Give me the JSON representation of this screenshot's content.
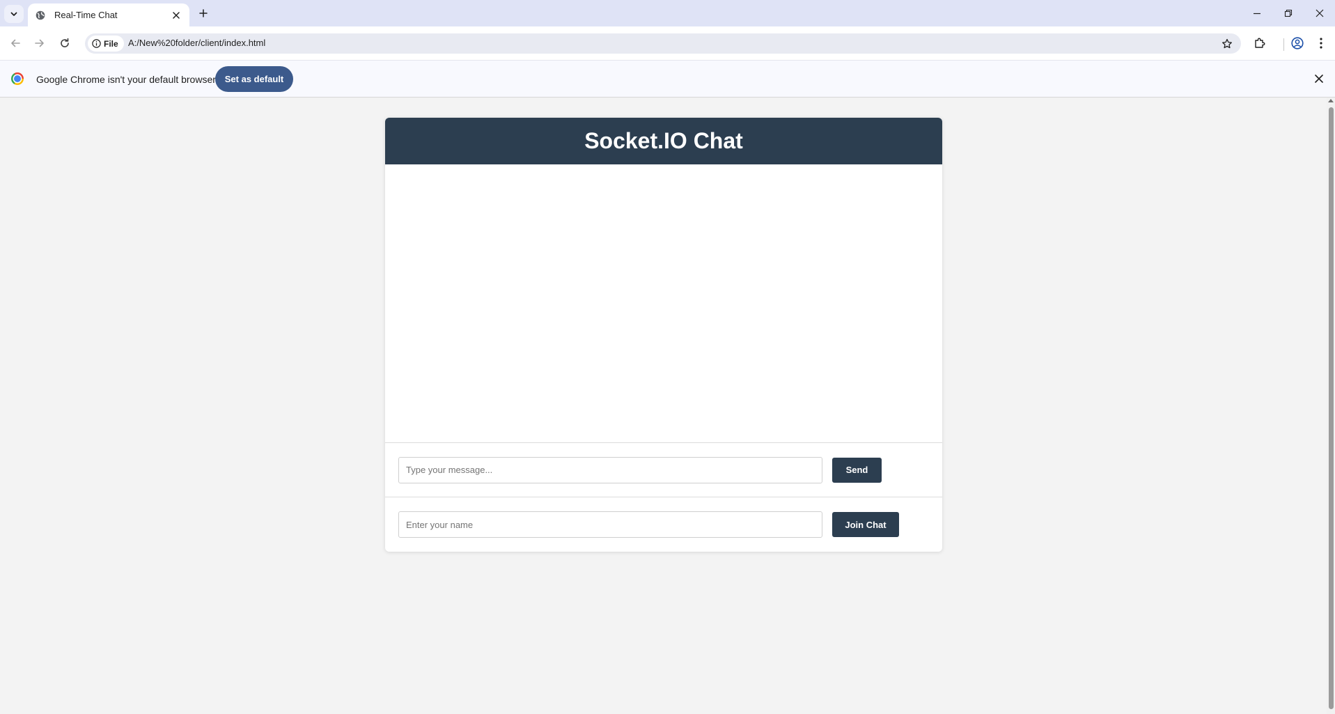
{
  "browser": {
    "tab": {
      "title": "Real-Time Chat",
      "favicon": "globe-icon"
    },
    "address_bar": {
      "chip_label": "File",
      "url": "A:/New%20folder/client/index.html"
    },
    "infobar": {
      "message": "Google Chrome isn't your default browser",
      "button_label": "Set as default"
    }
  },
  "chat": {
    "header_title": "Socket.IO Chat",
    "messages": [],
    "message_input": {
      "placeholder": "Type your message...",
      "value": ""
    },
    "send_label": "Send",
    "name_input": {
      "placeholder": "Enter your name",
      "value": ""
    },
    "join_label": "Join Chat"
  },
  "colors": {
    "header_bg": "#2c3e50",
    "button_bg": "#2c3e50",
    "page_bg": "#f3f3f3",
    "infobar_button": "#3c5a8c",
    "tabstrip_bg": "#dfe3f6"
  }
}
